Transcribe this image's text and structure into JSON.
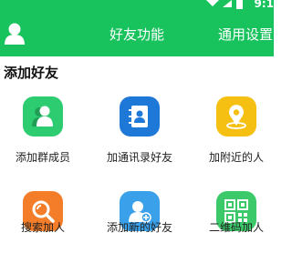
{
  "status": {
    "time": "9:1"
  },
  "header": {
    "title": "好友功能",
    "settings_label": "通用设置"
  },
  "section": {
    "title": "添加好友"
  },
  "features": [
    {
      "label": "添加群成员",
      "icon": "group-members-icon",
      "color": "#2ecc71"
    },
    {
      "label": "加通讯录好友",
      "icon": "contacts-book-icon",
      "color": "#1e78d8"
    },
    {
      "label": "加附近的人",
      "icon": "location-pin-icon",
      "color": "#f5c012"
    },
    {
      "label": "搜索加人",
      "icon": "search-icon",
      "color": "#f47d2a"
    },
    {
      "label": "添加新的好友",
      "icon": "add-user-icon",
      "color": "#3aa0ea"
    },
    {
      "label": "二维码加人",
      "icon": "qr-code-icon",
      "color": "#3cc96a"
    }
  ]
}
